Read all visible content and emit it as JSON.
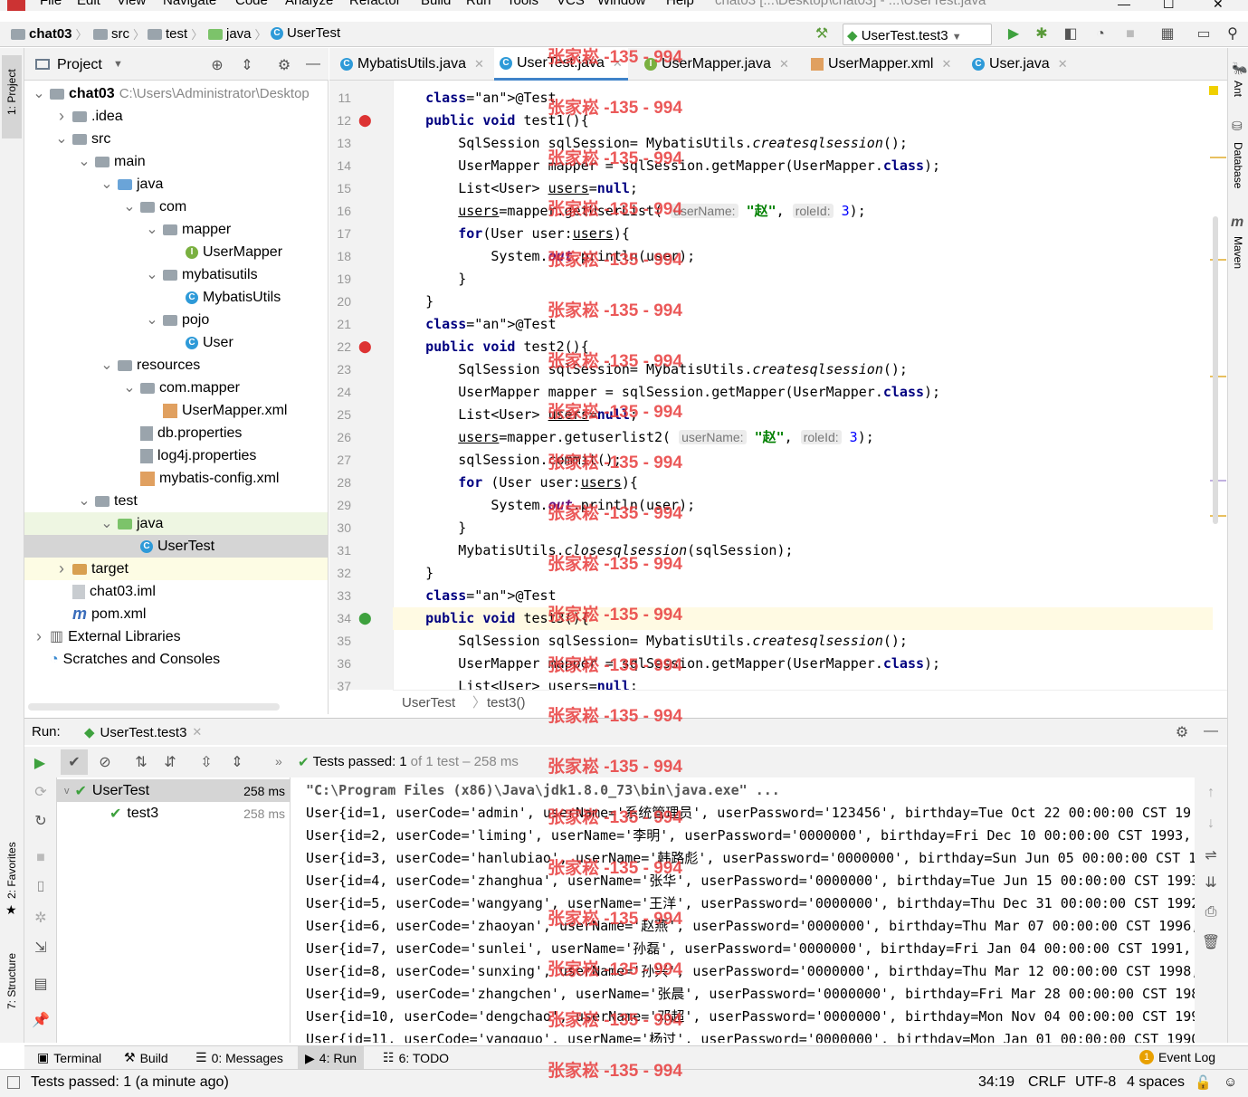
{
  "menu": {
    "items": [
      "File",
      "Edit",
      "View",
      "Navigate",
      "Code",
      "Analyze",
      "Refactor",
      "Build",
      "Run",
      "Tools",
      "VCS",
      "Window",
      "Help"
    ],
    "window_title": "chat03 [...\\Desktop\\chat03] - ...\\UserTest.java"
  },
  "nav": {
    "crumbs": [
      "chat03",
      "src",
      "test",
      "java",
      "UserTest"
    ],
    "run_config": "UserTest.test3"
  },
  "stripe": {
    "left_top": "1: Project",
    "left_fav": "2: Favorites",
    "left_struct": "7: Structure",
    "right": [
      "Ant",
      "Database",
      "Maven"
    ]
  },
  "project": {
    "title": "Project",
    "tree": [
      {
        "label": "chat03",
        "extra": "C:\\Users\\Administrator\\Desktop",
        "icon": "folder",
        "depth": 0,
        "arrow": "v"
      },
      {
        "label": ".idea",
        "icon": "folder",
        "depth": 1,
        "arrow": ">"
      },
      {
        "label": "src",
        "icon": "folder",
        "depth": 1,
        "arrow": "v"
      },
      {
        "label": "main",
        "icon": "folder",
        "depth": 2,
        "arrow": "v"
      },
      {
        "label": "java",
        "icon": "folder-blue",
        "depth": 3,
        "arrow": "v"
      },
      {
        "label": "com",
        "icon": "folder",
        "depth": 4,
        "arrow": "v"
      },
      {
        "label": "mapper",
        "icon": "folder",
        "depth": 5,
        "arrow": "v"
      },
      {
        "label": "UserMapper",
        "icon": "interface",
        "depth": 6,
        "arrow": ""
      },
      {
        "label": "mybatisutils",
        "icon": "folder",
        "depth": 5,
        "arrow": "v"
      },
      {
        "label": "MybatisUtils",
        "icon": "class",
        "depth": 6,
        "arrow": ""
      },
      {
        "label": "pojo",
        "icon": "folder",
        "depth": 5,
        "arrow": "v"
      },
      {
        "label": "User",
        "icon": "class",
        "depth": 6,
        "arrow": ""
      },
      {
        "label": "resources",
        "icon": "folder",
        "depth": 3,
        "arrow": "v"
      },
      {
        "label": "com.mapper",
        "icon": "folder",
        "depth": 4,
        "arrow": "v"
      },
      {
        "label": "UserMapper.xml",
        "icon": "xml",
        "depth": 5,
        "arrow": ""
      },
      {
        "label": "db.properties",
        "icon": "props",
        "depth": 4,
        "arrow": ""
      },
      {
        "label": "log4j.properties",
        "icon": "props",
        "depth": 4,
        "arrow": ""
      },
      {
        "label": "mybatis-config.xml",
        "icon": "xml",
        "depth": 4,
        "arrow": ""
      },
      {
        "label": "test",
        "icon": "folder",
        "depth": 2,
        "arrow": "v"
      },
      {
        "label": "java",
        "icon": "folder-green",
        "depth": 3,
        "arrow": "v"
      },
      {
        "label": "UserTest",
        "icon": "class",
        "depth": 4,
        "arrow": ""
      },
      {
        "label": "target",
        "icon": "folder-orange",
        "depth": 1,
        "arrow": ">"
      },
      {
        "label": "chat03.iml",
        "icon": "file",
        "depth": 1,
        "arrow": ""
      },
      {
        "label": "pom.xml",
        "icon": "maven",
        "depth": 1,
        "arrow": ""
      },
      {
        "label": "External Libraries",
        "icon": "libs",
        "depth": 0,
        "arrow": ">"
      },
      {
        "label": "Scratches and Consoles",
        "icon": "scratch",
        "depth": 0,
        "arrow": ""
      }
    ]
  },
  "tabs": [
    {
      "label": "MybatisUtils.java",
      "icon": "class"
    },
    {
      "label": "UserTest.java",
      "icon": "class"
    },
    {
      "label": "UserMapper.java",
      "icon": "interface"
    },
    {
      "label": "UserMapper.xml",
      "icon": "xml"
    },
    {
      "label": "User.java",
      "icon": "class"
    }
  ],
  "code": {
    "line_numbers": [
      "11",
      "12",
      "13",
      "14",
      "15",
      "16",
      "17",
      "18",
      "19",
      "20",
      "21",
      "22",
      "23",
      "24",
      "25",
      "26",
      "27",
      "28",
      "29",
      "30",
      "31",
      "32",
      "33",
      "34",
      "35",
      "36",
      "37"
    ],
    "lines": [
      "    @Test",
      "    public void test1(){",
      "        SqlSession sqlSession= MybatisUtils.createsqlsession();",
      "        UserMapper mapper = sqlSession.getMapper(UserMapper.class);",
      "        List<User> users=null;",
      "        users=mapper.getUserList( userName: \"赵\", roleId: 3);",
      "        for(User user:users){",
      "            System.out.println(user);",
      "        }",
      "    }",
      "    @Test",
      "    public void test2(){",
      "        SqlSession sqlSession= MybatisUtils.createsqlsession();",
      "        UserMapper mapper = sqlSession.getMapper(UserMapper.class);",
      "        List<User> users=null;",
      "        users=mapper.getuserlist2( userName: \"赵\", roleId: 3);",
      "        sqlSession.commit();",
      "        for (User user:users){",
      "            System.out.println(user);",
      "        }",
      "        MybatisUtils.closesqlsession(sqlSession);",
      "    }",
      "    @Test",
      "    public void test3(){",
      "        SqlSession sqlSession= MybatisUtils.createsqlsession();",
      "        UserMapper mapper = sqlSession.getMapper(UserMapper.class);",
      "        List<User> users=null;"
    ],
    "breadcrumb": [
      "UserTest",
      "test3()"
    ]
  },
  "run": {
    "label": "Run:",
    "tab": "UserTest.test3",
    "status_prefix": "Tests passed:",
    "status_count": "1",
    "status_suffix": "of 1 test – 258 ms",
    "tree": [
      {
        "label": "UserTest",
        "time": "258 ms"
      },
      {
        "label": "test3",
        "time": "258 ms"
      }
    ],
    "console": [
      "\"C:\\Program Files (x86)\\Java\\jdk1.8.0_73\\bin\\java.exe\" ...",
      "User{id=1, userCode='admin', userName='系统管理员', userPassword='123456', birthday=Tue Oct 22 00:00:00 CST 19",
      "User{id=2, userCode='liming', userName='李明', userPassword='0000000', birthday=Fri Dec 10 00:00:00 CST 1993,",
      "User{id=3, userCode='hanlubiao', userName='韩路彪', userPassword='0000000', birthday=Sun Jun 05 00:00:00 CST 1",
      "User{id=4, userCode='zhanghua', userName='张华', userPassword='0000000', birthday=Tue Jun 15 00:00:00 CST 1993",
      "User{id=5, userCode='wangyang', userName='王洋', userPassword='0000000', birthday=Thu Dec 31 00:00:00 CST 1992",
      "User{id=6, userCode='zhaoyan', userName='赵燕', userPassword='0000000', birthday=Thu Mar 07 00:00:00 CST 1996,",
      "User{id=7, userCode='sunlei', userName='孙磊', userPassword='0000000', birthday=Fri Jan 04 00:00:00 CST 1991,",
      "User{id=8, userCode='sunxing', userName='孙兴', userPassword='0000000', birthday=Thu Mar 12 00:00:00 CST 1998,",
      "User{id=9, userCode='zhangchen', userName='张晨', userPassword='0000000', birthday=Fri Mar 28 00:00:00 CST 198",
      "User{id=10, userCode='dengchao', userName='邓超', userPassword='0000000', birthday=Mon Nov 04 00:00:00 CST 199",
      "User{id=11, userCode='yangguo', userName='杨过', userPassword='0000000', birthday=Mon Jan 01 00:00:00 CST 1990"
    ]
  },
  "toolwindows": [
    {
      "label": "Terminal"
    },
    {
      "label": "Build"
    },
    {
      "label": "0: Messages"
    },
    {
      "label": "4: Run"
    },
    {
      "label": "6: TODO"
    }
  ],
  "event_log": "Event Log",
  "event_count": "1",
  "status": {
    "message": "Tests passed: 1 (a minute ago)",
    "position": "34:19",
    "line_sep": "CRLF",
    "encoding": "UTF-8",
    "indent": "4 spaces"
  },
  "watermark": "张家崧 -135 - 994"
}
